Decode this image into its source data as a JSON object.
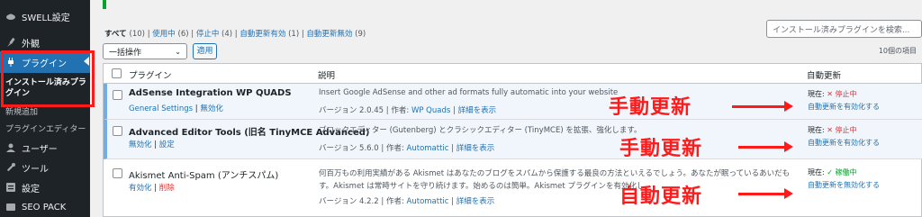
{
  "sidebar": {
    "items": [
      {
        "label": "SWELL設定",
        "icon": "swell-icon"
      },
      {
        "label": "外観",
        "icon": "brush-icon"
      },
      {
        "label": "プラグイン",
        "icon": "plugin-icon"
      },
      {
        "label": "ユーザー",
        "icon": "user-icon"
      },
      {
        "label": "ツール",
        "icon": "wrench-icon"
      },
      {
        "label": "設定",
        "icon": "settings-icon"
      },
      {
        "label": "SEO PACK",
        "icon": "seo-icon"
      }
    ],
    "subitems": [
      "インストール済みプラグイン",
      "新規追加",
      "プラグインエディター"
    ]
  },
  "filters": {
    "all": "すべて",
    "all_count": "(10)",
    "active": "使用中",
    "active_count": "(6)",
    "inactive": "停止中",
    "inactive_count": "(4)",
    "autoupdate_on": "自動更新有効",
    "autoupdate_on_count": "(1)",
    "autoupdate_off": "自動更新無効",
    "autoupdate_off_count": "(9)",
    "sep": "|"
  },
  "search": {
    "placeholder": "インストール済みプラグインを検索..."
  },
  "bulk": {
    "label": "一括操作",
    "apply": "適用",
    "count": "10個の項目"
  },
  "table": {
    "col_plugin": "プラグイン",
    "col_desc": "説明",
    "col_auto": "自動更新"
  },
  "plugins": [
    {
      "name": "AdSense Integration WP QUADS",
      "link1": "General Settings",
      "link2": "無効化",
      "desc": "Insert Google AdSense and other ad formats fully automatic into your website",
      "version": "バージョン 2.0.45",
      "author_label": "作者:",
      "author": "WP Quads",
      "details": "詳細を表示",
      "status_label": "現在:",
      "status": "✕ 停止中",
      "toggle": "自動更新を有効化する",
      "annotation": "手動更新"
    },
    {
      "name": "Advanced Editor Tools (旧名 TinyMCE Advanced)",
      "link1": "無効化",
      "link2": "設定",
      "desc": "ブロックエディター (Gutenberg) とクラシックエディター (TinyMCE) を拡張、強化します。",
      "version": "バージョン 5.6.0",
      "author_label": "作者:",
      "author": "Automattic",
      "details": "詳細を表示",
      "status_label": "現在:",
      "status": "✕ 停止中",
      "toggle": "自動更新を有効化する",
      "annotation": "手動更新"
    },
    {
      "name": "Akismet Anti-Spam (アンチスパム)",
      "link1": "有効化",
      "link2": "削除",
      "desc": "何百万もの利用実績がある Akismet はあなたのブログをスパムから保護する最良の方法といえるでしょう。あなたが眠っているあいだも",
      "desc2": "す。Akismet は常時サイトを守り続けます。始めるのは簡単。Akismet プラグインを有効化し",
      "version": "バージョン 4.2.2",
      "author_label": "作者:",
      "author": "Automattic",
      "details": "詳細を表示",
      "status_label": "現在:",
      "status": "✓ 稼働中",
      "toggle": "自動更新を無効化する",
      "annotation": "自動更新"
    }
  ],
  "colors": {
    "accent": "#2271b1",
    "annotation": "#ff1a1a",
    "sidebar": "#1d2327"
  }
}
